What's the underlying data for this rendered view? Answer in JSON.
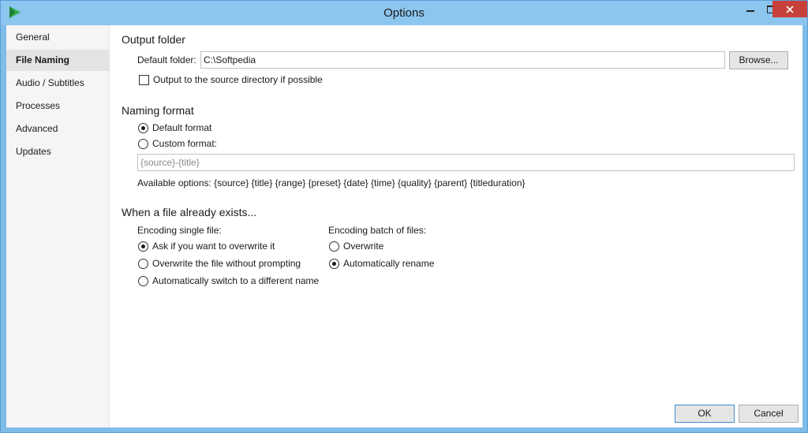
{
  "window": {
    "title": "Options"
  },
  "sidebar": {
    "items": [
      {
        "label": "General"
      },
      {
        "label": "File Naming",
        "active": true
      },
      {
        "label": "Audio / Subtitles"
      },
      {
        "label": "Processes"
      },
      {
        "label": "Advanced"
      },
      {
        "label": "Updates"
      }
    ]
  },
  "output_folder": {
    "header": "Output folder",
    "default_folder_label": "Default folder:",
    "default_folder_value": "C:\\Softpedia",
    "browse_label": "Browse...",
    "source_dir_label": "Output to the source directory if possible",
    "source_dir_checked": false
  },
  "naming_format": {
    "header": "Naming format",
    "default_label": "Default format",
    "custom_label": "Custom format:",
    "selected": "default",
    "custom_placeholder": "{source}-{title}",
    "available_options": "Available options: {source} {title} {range} {preset} {date} {time} {quality} {parent} {titleduration}"
  },
  "file_exists": {
    "header": "When a file already exists...",
    "single": {
      "label": "Encoding single file:",
      "options": [
        "Ask if you want to overwrite it",
        "Overwrite the file without prompting",
        "Automatically switch to a different name"
      ],
      "selected_index": 0
    },
    "batch": {
      "label": "Encoding batch of files:",
      "options": [
        "Overwrite",
        "Automatically rename"
      ],
      "selected_index": 1
    }
  },
  "footer": {
    "ok_label": "OK",
    "cancel_label": "Cancel"
  },
  "colors": {
    "title_bar": "#8cc5ee",
    "close_button": "#c7403a",
    "default_button_border": "#3c8fd6"
  },
  "icons": {
    "app": "play-arrow-icon",
    "minimize": "minimize-icon",
    "maximize": "maximize-icon",
    "close": "close-icon"
  }
}
